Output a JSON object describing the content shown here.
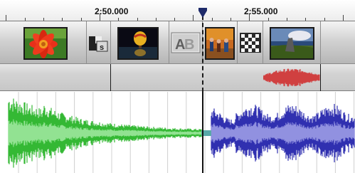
{
  "ruler": {
    "labels": [
      "2:50.000",
      "2:55.000"
    ]
  },
  "video_track": {
    "clips": [
      {
        "name": "red flower",
        "icon": "flower-thumbnail"
      },
      {
        "name": "slide transition",
        "icon": "transition-slide-icon"
      },
      {
        "name": "hot air balloon",
        "icon": "balloon-thumbnail"
      },
      {
        "name": "A/B crossfade transition",
        "icon": "transition-ab-icon"
      },
      {
        "name": "people under autumn trees",
        "icon": "autumn-thumbnail"
      },
      {
        "name": "mosaic transition",
        "icon": "transition-mosaic-icon"
      },
      {
        "name": "standing stone landscape",
        "icon": "landscape-thumbnail"
      }
    ]
  },
  "audio_track": {
    "clips": [
      {
        "name": "green audio clip",
        "color": "#3cbd3c"
      },
      {
        "name": "blue audio clip",
        "color": "#3838b4"
      }
    ],
    "transition_waveform_color": "#d94848"
  },
  "colors": {
    "green_wave": "#35b935",
    "green_wave_inner": "#9ae69a",
    "blue_wave": "#3030b0",
    "blue_wave_inner": "#9a9ae4",
    "red_wave": "#d04040",
    "grid": "#d0d0d0"
  }
}
